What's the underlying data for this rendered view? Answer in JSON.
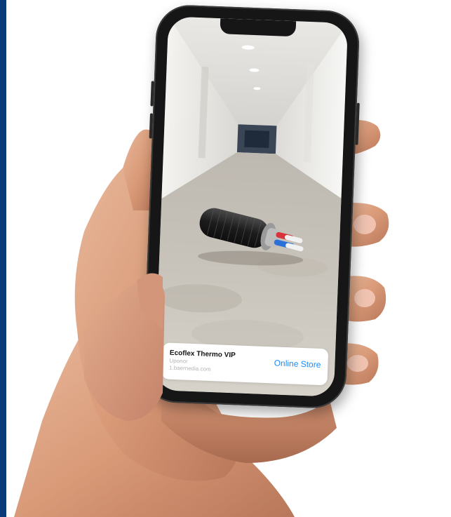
{
  "colors": {
    "brand_band": "#0b3a78",
    "link": "#1a8cff",
    "card_title": "#111111",
    "card_meta": "#b5b5b5",
    "phone_body": "#161616"
  },
  "ar_quicklook": {
    "product_title": "Ecoflex Thermo VIP",
    "subtitle": "Uponor",
    "domain": "1.baernedia.com",
    "store_label": "Online Store"
  },
  "scene": {
    "object": "pre-insulated-pipe-model",
    "environment": "office-corridor"
  }
}
